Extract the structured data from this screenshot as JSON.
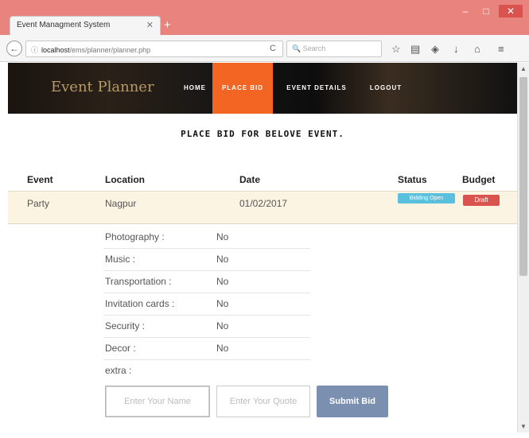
{
  "browser": {
    "tab_title": "Event Managment System",
    "tab_close": "✕",
    "new_tab": "+",
    "window_minimize": "–",
    "window_maximize": "□",
    "window_close": "✕",
    "back_icon": "arrow-left-icon",
    "url_info": "ⓘ",
    "url_host": "localhost",
    "url_path": "/ems/planner/planner.php",
    "reload": "C",
    "search_placeholder": "🔍 Search",
    "toolbar_icons": [
      "star-icon",
      "library-icon",
      "pocket-icon",
      "download-icon",
      "home-icon",
      "menu-icon"
    ]
  },
  "site": {
    "brand": "Event Planner",
    "menu": [
      {
        "label": "HOME",
        "active": false
      },
      {
        "label": "PLACE BID",
        "active": true
      },
      {
        "label": "EVENT DETAILS",
        "active": false
      },
      {
        "label": "LOGOUT",
        "active": false
      }
    ],
    "accent_color": "#f26522"
  },
  "main": {
    "heading": "PLACE BID FOR BELOVE EVENT."
  },
  "event_table": {
    "headers": [
      "Event",
      "Location",
      "Date",
      "Status",
      "Budget"
    ],
    "row": {
      "event": "Party",
      "location": "Nagpur",
      "date": "01/02/2017",
      "status": "Bidding Open",
      "budget": "Draft"
    }
  },
  "details": [
    {
      "label": "Photography :",
      "value": "No"
    },
    {
      "label": "Music :",
      "value": "No"
    },
    {
      "label": "Transportation :",
      "value": "No"
    },
    {
      "label": "Invitation cards :",
      "value": "No"
    },
    {
      "label": "Security :",
      "value": "No"
    },
    {
      "label": "Decor :",
      "value": "No"
    },
    {
      "label": "extra :",
      "value": ""
    }
  ],
  "bid_form": {
    "name_placeholder": "Enter Your Name",
    "quote_placeholder": "Enter Your Quote",
    "submit_label": "Submit Bid"
  }
}
